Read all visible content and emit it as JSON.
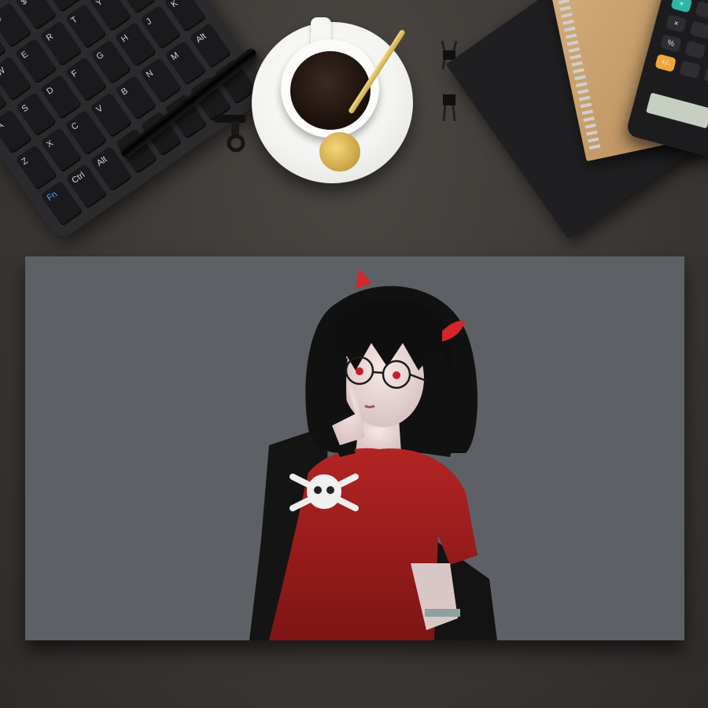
{
  "scene": {
    "description_label": "",
    "keyboard_keys": [
      "!",
      "@",
      "#",
      "$",
      "%",
      "^",
      "&",
      "*",
      "Q",
      "W",
      "E",
      "R",
      "T",
      "Y",
      "U",
      "I",
      "A",
      "S",
      "D",
      "F",
      "G",
      "H",
      "J",
      "K",
      "Z",
      "X",
      "C",
      "V",
      "B",
      "N",
      "M",
      "Alt",
      "Fn",
      "Ctrl",
      "Alt",
      "",
      "",
      "",
      "",
      ""
    ],
    "calculator_keys": [
      "+",
      "",
      "",
      "×",
      "",
      "",
      "%",
      "",
      "",
      "+/-",
      "",
      ""
    ],
    "colors": {
      "desk": "#3e3a37",
      "canvas_bg": "#5d6166",
      "shirt": "#a71f1f",
      "hair": "#111111",
      "horn": "#d4262b"
    }
  }
}
